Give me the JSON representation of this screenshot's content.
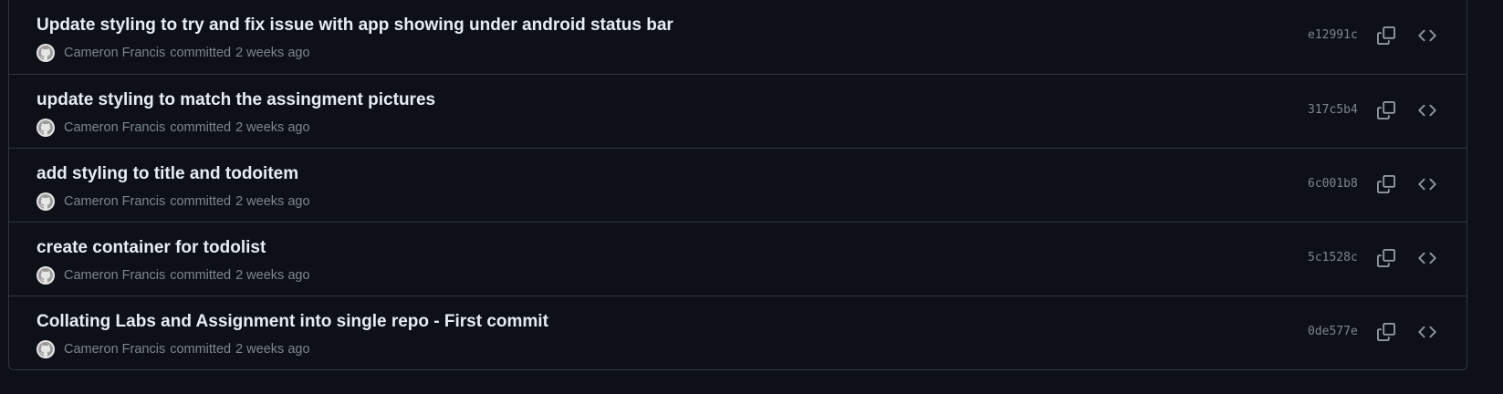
{
  "commits": [
    {
      "title": "Update styling to try and fix issue with app showing under android status bar",
      "author": "Cameron Francis",
      "action": "committed",
      "time": "2 weeks ago",
      "sha": "e12991c"
    },
    {
      "title": "update styling to match the assingment pictures",
      "author": "Cameron Francis",
      "action": "committed",
      "time": "2 weeks ago",
      "sha": "317c5b4"
    },
    {
      "title": "add styling to title and todoitem",
      "author": "Cameron Francis",
      "action": "committed",
      "time": "2 weeks ago",
      "sha": "6c001b8"
    },
    {
      "title": "create container for todolist",
      "author": "Cameron Francis",
      "action": "committed",
      "time": "2 weeks ago",
      "sha": "5c1528c"
    },
    {
      "title": "Collating Labs and Assignment into single repo - First commit",
      "author": "Cameron Francis",
      "action": "committed",
      "time": "2 weeks ago",
      "sha": "0de577e"
    }
  ],
  "icons": {
    "avatar": "github-avatar-icon",
    "copy": "copy-icon",
    "browse": "code-icon"
  },
  "colors": {
    "background": "#0d1117",
    "border": "#30363d",
    "title": "#e6edf3",
    "muted": "#7d8590"
  }
}
